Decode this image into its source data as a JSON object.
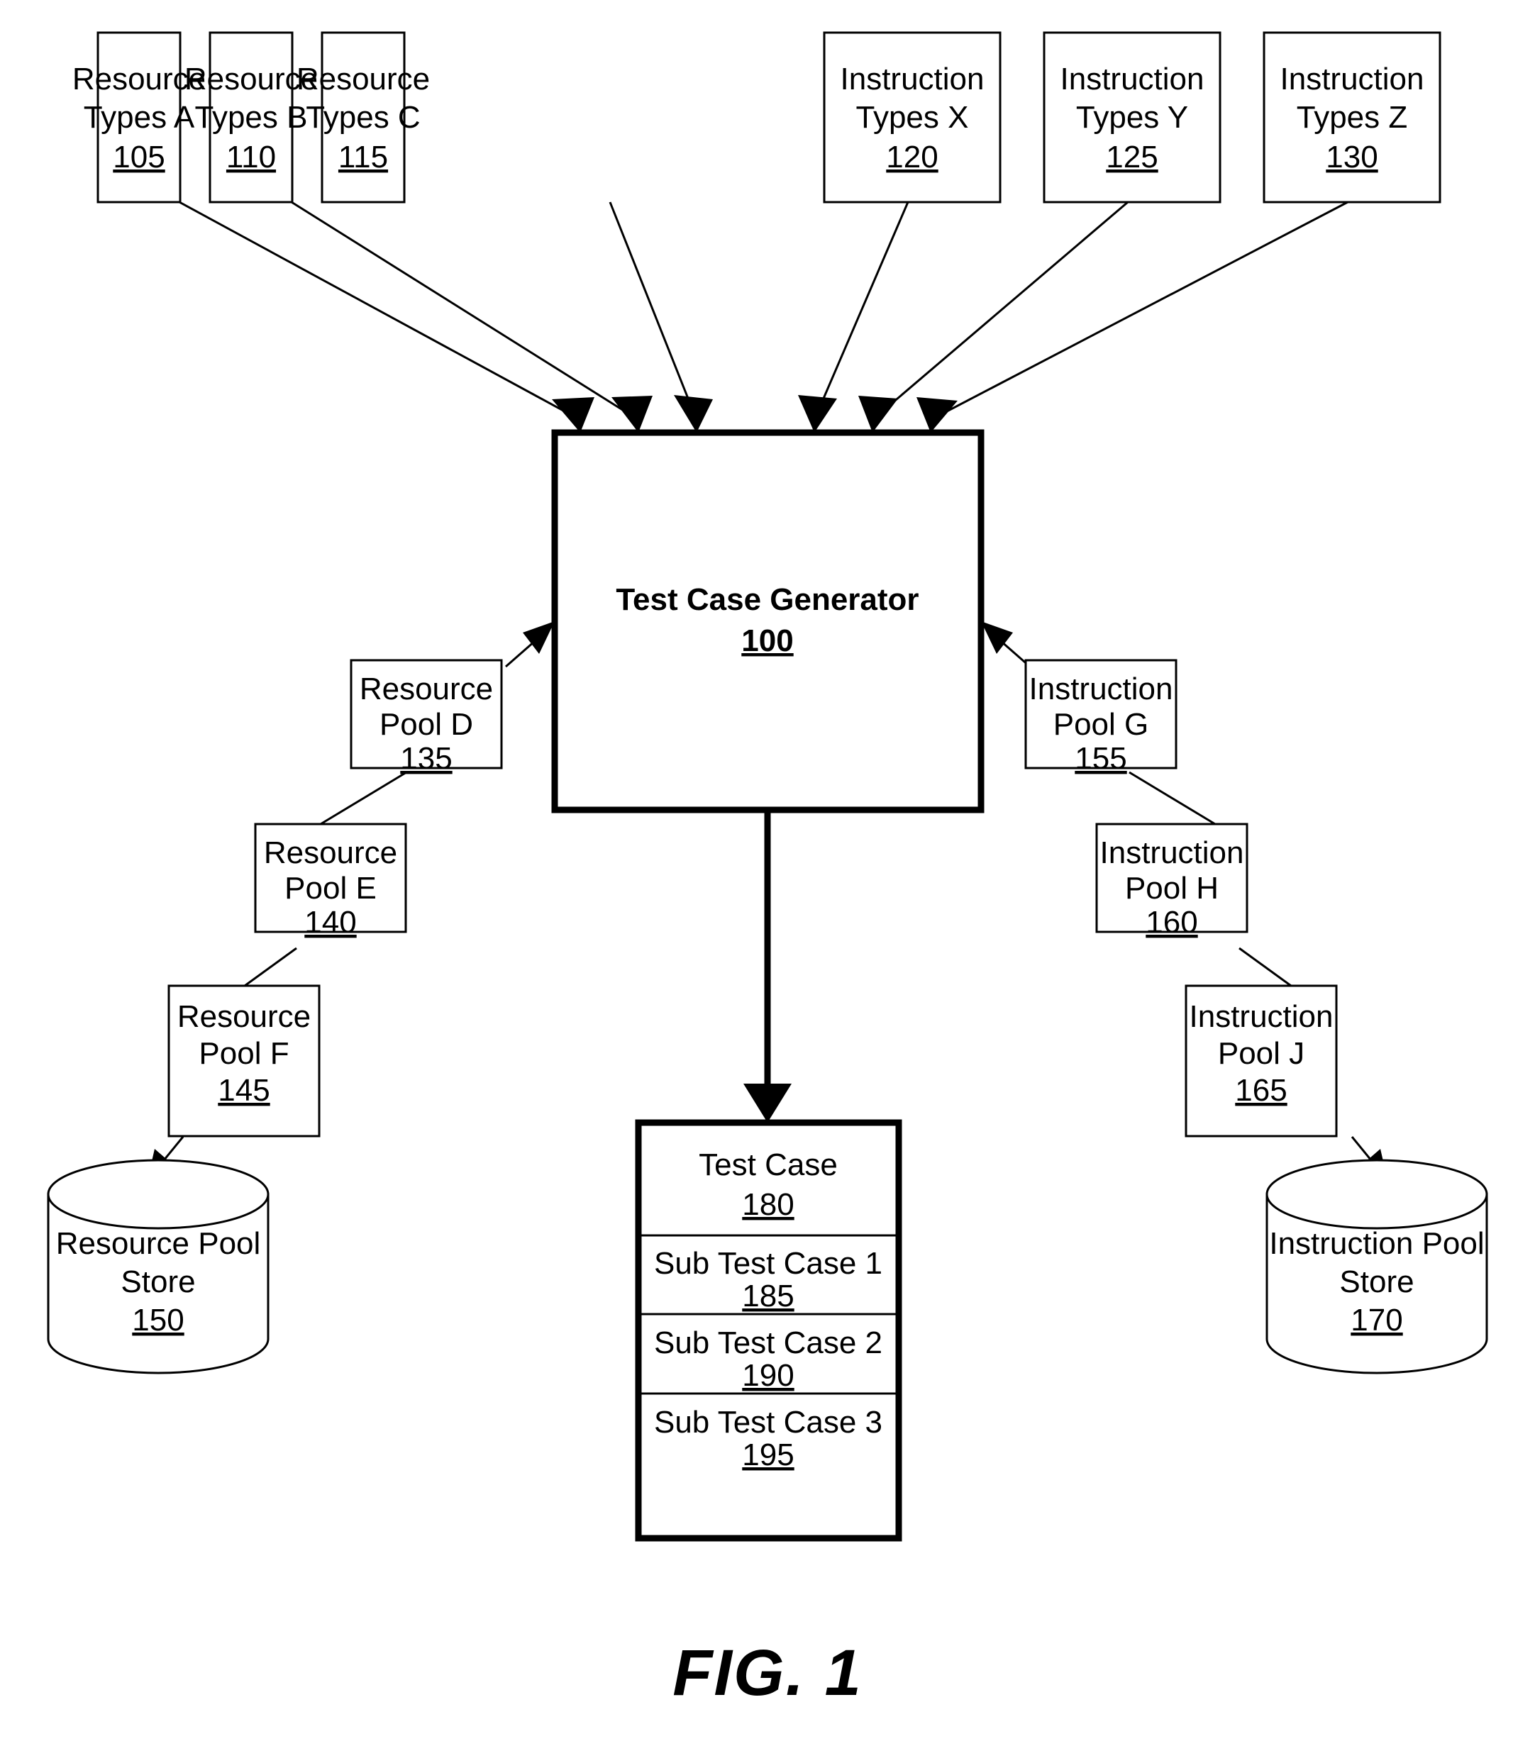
{
  "figure": {
    "caption": "FIG. 1",
    "colors": {
      "line": "#000000",
      "fill": "#ffffff",
      "background": "#ffffff"
    }
  },
  "top_row": {
    "nodes": [
      {
        "line1": "Resource",
        "line2": "Types A",
        "ref": "105"
      },
      {
        "line1": "Resource",
        "line2": "Types B",
        "ref": "110"
      },
      {
        "line1": "Resource",
        "line2": "Types C",
        "ref": "115"
      },
      {
        "line1": "Instruction",
        "line2": "Types X",
        "ref": "120"
      },
      {
        "line1": "Instruction",
        "line2": "Types Y",
        "ref": "125"
      },
      {
        "line1": "Instruction",
        "line2": "Types Z",
        "ref": "130"
      }
    ]
  },
  "generator": {
    "label": "Test Case Generator",
    "ref": "100"
  },
  "left_chain": {
    "nodes": [
      {
        "line1": "Resource",
        "line2": "Pool D",
        "ref": "135"
      },
      {
        "line1": "Resource",
        "line2": "Pool E",
        "ref": "140"
      },
      {
        "line1": "Resource",
        "line2": "Pool F",
        "ref": "145"
      }
    ],
    "store": {
      "line1": "Resource Pool",
      "line2": "Store",
      "ref": "150"
    }
  },
  "right_chain": {
    "nodes": [
      {
        "line1": "Instruction",
        "line2": "Pool G",
        "ref": "155"
      },
      {
        "line1": "Instruction",
        "line2": "Pool H",
        "ref": "160"
      },
      {
        "line1": "Instruction",
        "line2": "Pool J",
        "ref": "165"
      }
    ],
    "store": {
      "line1": "Instruction Pool",
      "line2": "Store",
      "ref": "170"
    }
  },
  "test_case": {
    "header": {
      "label": "Test Case",
      "ref": "180"
    },
    "subcases": [
      {
        "label": "Sub Test Case 1",
        "ref": "185"
      },
      {
        "label": "Sub Test Case 2",
        "ref": "190"
      },
      {
        "label": "Sub Test Case 3",
        "ref": "195"
      }
    ]
  }
}
